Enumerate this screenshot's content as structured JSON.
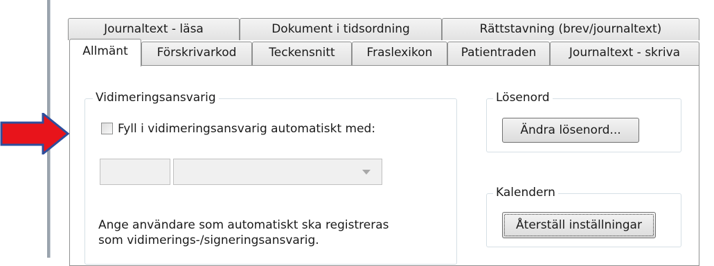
{
  "tabs": {
    "row1": [
      "Journaltext - läsa",
      "Dokument i tidsordning",
      "Rättstavning (brev/journaltext)"
    ],
    "row2": [
      "Allmänt",
      "Förskrivarkod",
      "Teckensnitt",
      "Fraslexikon",
      "Patientraden",
      "Journaltext - skriva"
    ]
  },
  "vidimering": {
    "title": "Vidimeringsansvarig",
    "checkbox_label": "Fyll i vidimeringsansvarig automatiskt med:",
    "checked": false,
    "description_line1": "Ange användare som automatiskt ska registreras",
    "description_line2": "som vidimerings-/signeringsansvarig."
  },
  "password": {
    "title": "Lösenord",
    "button": "Ändra lösenord..."
  },
  "calendar": {
    "title": "Kalendern",
    "button": "Återställ inställningar"
  },
  "colors": {
    "arrow_fill": "#e8141b",
    "arrow_stroke": "#2e4e9c"
  }
}
